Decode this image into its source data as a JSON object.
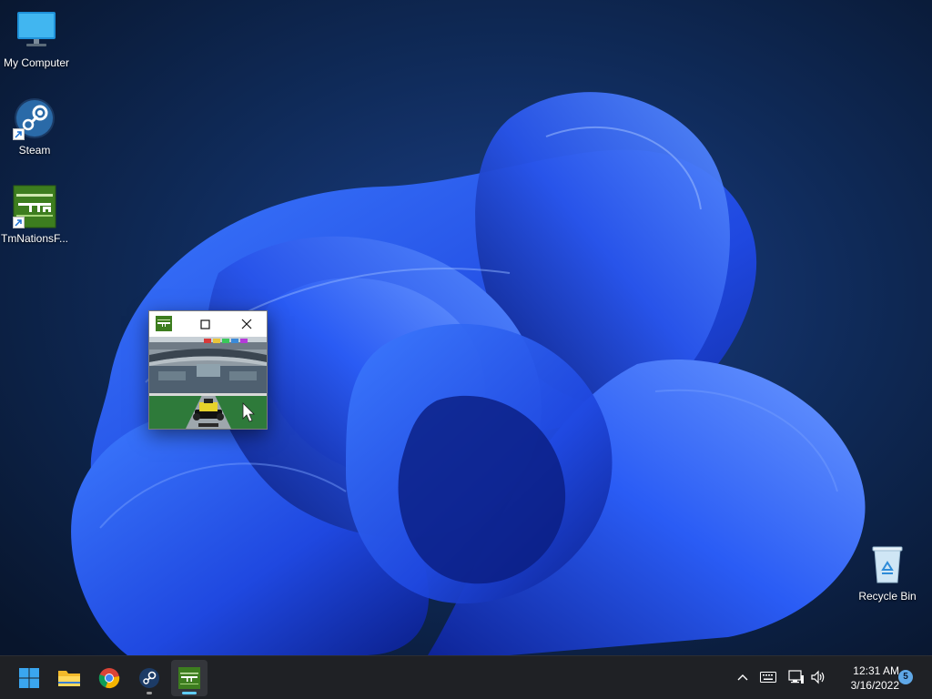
{
  "desktop": {
    "icons": [
      {
        "label": "My Computer",
        "icon": "monitor-icon"
      },
      {
        "label": "Steam",
        "icon": "steam-icon"
      },
      {
        "label": "TmNationsF...",
        "icon": "tmnations-icon"
      },
      {
        "label": "Recycle Bin",
        "icon": "recycle-bin-icon"
      }
    ]
  },
  "window": {
    "title_icon": "tmnations-icon",
    "buttons": [
      "minimize-icon",
      "maximize-icon",
      "close-icon"
    ],
    "content": "game-screenshot"
  },
  "taskbar": {
    "apps": [
      {
        "name": "Start",
        "icon": "windows-start-icon"
      },
      {
        "name": "File Explorer",
        "icon": "folder-icon"
      },
      {
        "name": "Google Chrome",
        "icon": "chrome-icon"
      },
      {
        "name": "Steam",
        "icon": "steam-icon"
      },
      {
        "name": "TmNationsForever",
        "icon": "tmnations-icon"
      }
    ],
    "tray": [
      "chevron-up-icon",
      "keyboard-icon",
      "network-icon",
      "volume-icon"
    ],
    "clock": {
      "time": "12:31 AM",
      "date": "3/16/2022"
    },
    "notifications": "5"
  },
  "colors": {
    "accent": "#60cdff",
    "taskbar": "#1f2125",
    "wallpaper_dark": "#0b1b33",
    "wallpaper_blue": "#1a4bd8"
  }
}
